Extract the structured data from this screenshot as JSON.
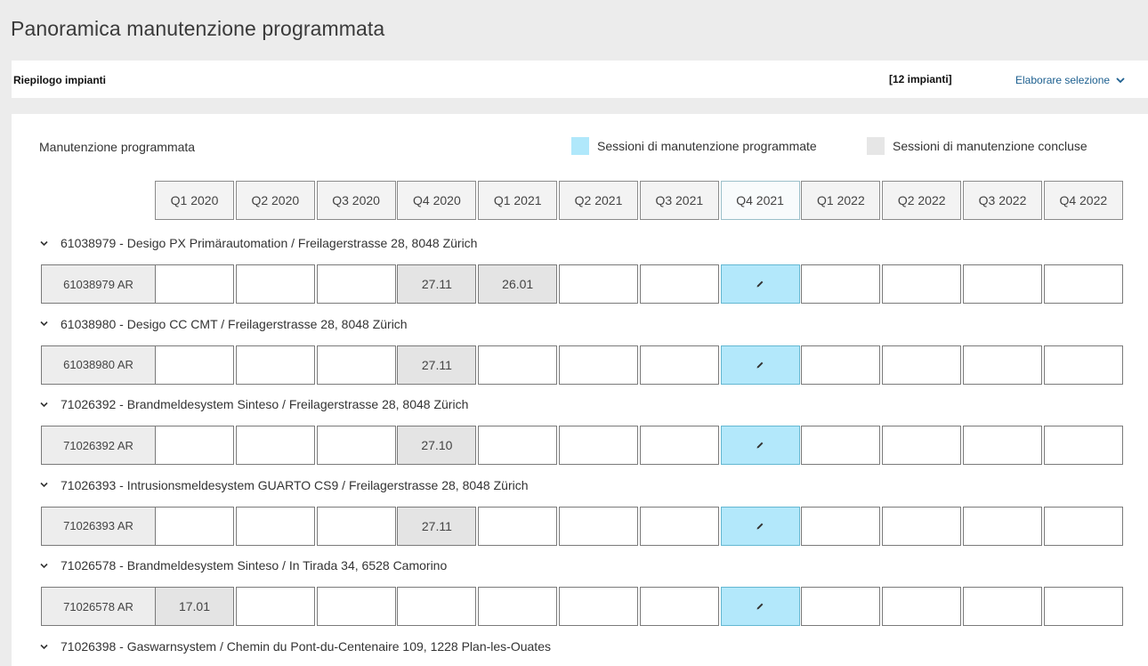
{
  "page": {
    "title": "Panoramica manutenzione programmata"
  },
  "summary": {
    "title": "Riepilogo impianti",
    "count": "[12 impianti]",
    "action_label": "Elaborare selezione",
    "action_icon": "chevron-down-icon"
  },
  "main": {
    "section_title": "Manutenzione programmata",
    "legend": {
      "planned_label": "Sessioni di manutenzione programmate",
      "done_label": "Sessioni di manutenzione concluse",
      "planned_color": "#b0e8fb",
      "done_color": "#e6e6e6"
    },
    "quarters": [
      "Q1 2020",
      "Q2 2020",
      "Q3 2020",
      "Q4 2020",
      "Q1 2021",
      "Q2 2021",
      "Q3 2021",
      "Q4 2021",
      "Q1 2022",
      "Q2 2022",
      "Q3 2022",
      "Q4 2022"
    ],
    "current_quarter": "Q4 2021",
    "groups": [
      {
        "header": "61038979 - Desigo PX Primärautomation / Freilagerstrasse 28, 8048 Zürich",
        "row_label": "61038979 AR",
        "cells": [
          "",
          "",
          "",
          "27.11",
          "26.01",
          "",
          "",
          "",
          "",
          "",
          "",
          ""
        ],
        "status": [
          "empty",
          "empty",
          "empty",
          "done",
          "done",
          "empty",
          "empty",
          "planned",
          "empty",
          "empty",
          "empty",
          "empty"
        ]
      },
      {
        "header": "61038980 - Desigo CC CMT / Freilagerstrasse 28, 8048 Zürich",
        "row_label": "61038980 AR",
        "cells": [
          "",
          "",
          "",
          "27.11",
          "",
          "",
          "",
          "",
          "",
          "",
          "",
          ""
        ],
        "status": [
          "empty",
          "empty",
          "empty",
          "done",
          "empty",
          "empty",
          "empty",
          "planned",
          "empty",
          "empty",
          "empty",
          "empty"
        ]
      },
      {
        "header": "71026392 - Brandmeldesystem Sinteso / Freilagerstrasse 28, 8048 Zürich",
        "row_label": "71026392 AR",
        "cells": [
          "",
          "",
          "",
          "27.10",
          "",
          "",
          "",
          "",
          "",
          "",
          "",
          ""
        ],
        "status": [
          "empty",
          "empty",
          "empty",
          "done",
          "empty",
          "empty",
          "empty",
          "planned",
          "empty",
          "empty",
          "empty",
          "empty"
        ]
      },
      {
        "header": "71026393 - Intrusionsmeldesystem GUARTO CS9 / Freilagerstrasse 28, 8048 Zürich",
        "row_label": "71026393 AR",
        "cells": [
          "",
          "",
          "",
          "27.11",
          "",
          "",
          "",
          "",
          "",
          "",
          "",
          ""
        ],
        "status": [
          "empty",
          "empty",
          "empty",
          "done",
          "empty",
          "empty",
          "empty",
          "planned",
          "empty",
          "empty",
          "empty",
          "empty"
        ]
      },
      {
        "header": "71026578 - Brandmeldesystem Sinteso / In Tirada 34, 6528 Camorino",
        "row_label": "71026578 AR",
        "cells": [
          "17.01",
          "",
          "",
          "",
          "",
          "",
          "",
          "",
          "",
          "",
          "",
          ""
        ],
        "status": [
          "done",
          "empty",
          "empty",
          "empty",
          "empty",
          "empty",
          "empty",
          "planned",
          "empty",
          "empty",
          "empty",
          "empty"
        ]
      },
      {
        "header": "71026398 - Gaswarnsystem / Chemin du Pont-du-Centenaire 109, 1228 Plan-les-Ouates",
        "row_label": "",
        "cells": [],
        "status": []
      }
    ]
  }
}
